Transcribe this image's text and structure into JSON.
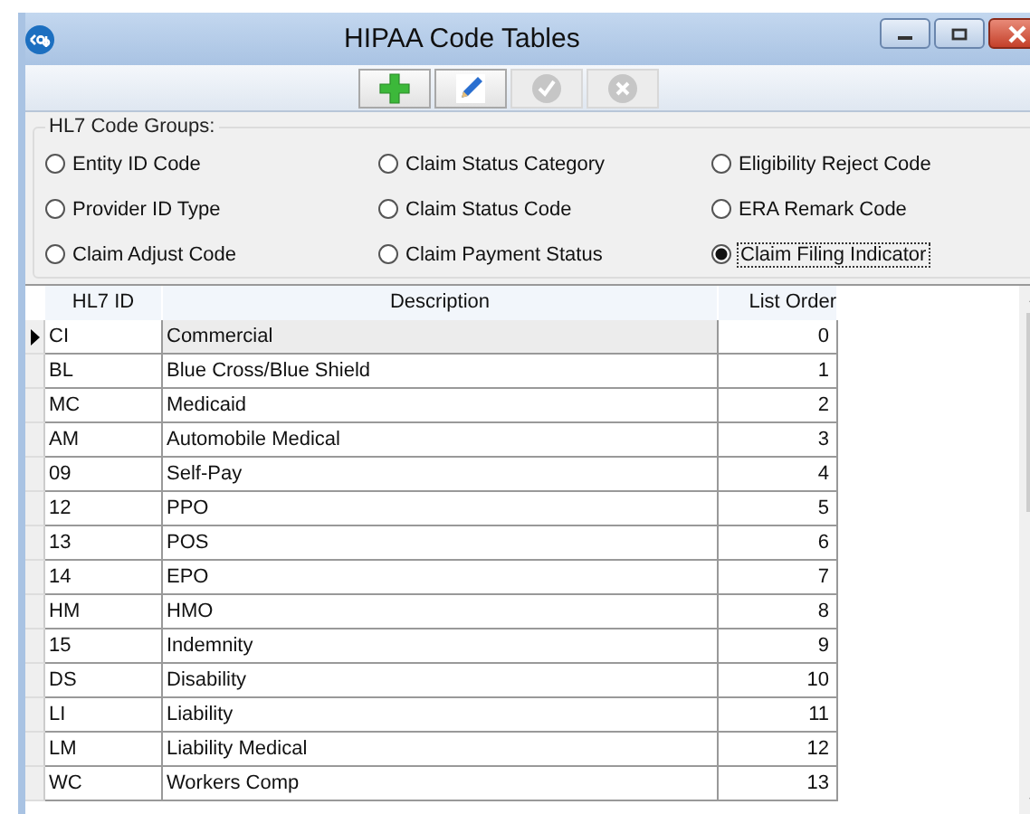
{
  "window": {
    "title": "HIPAA Code Tables"
  },
  "toolbar": [
    {
      "kind": "add",
      "disabled": false
    },
    {
      "kind": "edit",
      "disabled": false
    },
    {
      "kind": "ok",
      "disabled": true
    },
    {
      "kind": "cancel",
      "disabled": true
    }
  ],
  "code_groups": {
    "label": "HL7 Code Groups:",
    "options": [
      {
        "label": "Entity ID Code",
        "selected": false
      },
      {
        "label": "Claim Status Category",
        "selected": false
      },
      {
        "label": "Eligibility Reject Code",
        "selected": false
      },
      {
        "label": "Provider ID Type",
        "selected": false
      },
      {
        "label": "Claim Status Code",
        "selected": false
      },
      {
        "label": "ERA Remark Code",
        "selected": false
      },
      {
        "label": "Claim Adjust Code",
        "selected": false
      },
      {
        "label": "Claim Payment Status",
        "selected": false
      },
      {
        "label": "Claim Filing Indicator",
        "selected": true
      }
    ]
  },
  "table": {
    "columns": [
      "HL7 ID",
      "Description",
      "List Order"
    ],
    "rows": [
      {
        "cells": [
          "CI",
          "Commercial",
          "0"
        ],
        "selected": true
      },
      {
        "cells": [
          "BL",
          "Blue Cross/Blue Shield",
          "1"
        ],
        "selected": false
      },
      {
        "cells": [
          "MC",
          "Medicaid",
          "2"
        ],
        "selected": false
      },
      {
        "cells": [
          "AM",
          "Automobile Medical",
          "3"
        ],
        "selected": false
      },
      {
        "cells": [
          "09",
          "Self-Pay",
          "4"
        ],
        "selected": false
      },
      {
        "cells": [
          "12",
          "PPO",
          "5"
        ],
        "selected": false
      },
      {
        "cells": [
          "13",
          "POS",
          "6"
        ],
        "selected": false
      },
      {
        "cells": [
          "14",
          "EPO",
          "7"
        ],
        "selected": false
      },
      {
        "cells": [
          "HM",
          "HMO",
          "8"
        ],
        "selected": false
      },
      {
        "cells": [
          "15",
          "Indemnity",
          "9"
        ],
        "selected": false
      },
      {
        "cells": [
          "DS",
          "Disability",
          "10"
        ],
        "selected": false
      },
      {
        "cells": [
          "LI",
          "Liability",
          "11"
        ],
        "selected": false
      },
      {
        "cells": [
          "LM",
          "Liability Medical",
          "12"
        ],
        "selected": false
      },
      {
        "cells": [
          "WC",
          "Workers Comp",
          "13"
        ],
        "selected": false
      }
    ]
  }
}
